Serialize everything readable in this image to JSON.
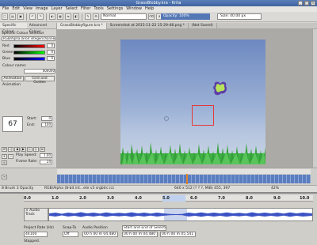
{
  "window": {
    "title": "GrassBlobby.kra - Krita"
  },
  "menubar": [
    "File",
    "Edit",
    "View",
    "Image",
    "Layer",
    "Select",
    "Filter",
    "Tools",
    "Settings",
    "Window",
    "Help"
  ],
  "toolbar": {
    "blend_mode": "Normal",
    "opacity": "Opacity: 100%",
    "size": "Size: 40.00 px"
  },
  "tabs": [
    {
      "label": "Specific Colour..."
    },
    {
      "label": "Advanced Colour..."
    },
    {
      "label": "GrassBlobbyfigure.kra *"
    },
    {
      "label": "Screenshot at 2015-11-22 15-29-48.png *"
    },
    {
      "label": "(Not Saved)"
    }
  ],
  "left_panel": {
    "tabs": [
      "Specific Colour...",
      "Advanced Colour..."
    ],
    "color_model_label": "Specific Colour Selector",
    "color_space": "RGB/Alpha (8-bit integer/channel)",
    "channels": [
      {
        "name": "Red",
        "value": "0"
      },
      {
        "name": "Green",
        "value": "0"
      },
      {
        "name": "Blue",
        "value": "0"
      }
    ],
    "colour_name_label": "Colour name:",
    "hex_value": "000000",
    "animation_tab": "Animation",
    "grid_tab": "Grid and Guides",
    "animation_label": "Animation",
    "current_frame": "67",
    "start_label": "Start:",
    "start_value": "0",
    "end_label": "End:",
    "end_value": "100",
    "play_speed_label": "Play Speed:",
    "play_speed": "1.00",
    "frame_rate_label": "Frame Rate:",
    "frame_rate": "24"
  },
  "statusbar": {
    "color_info": "8 Brush 3 Opacity",
    "layer_info": "RGB/Alpha (8-bit int...ete v3 srgbtrc.icc",
    "size_info": "640 x 512 (? ? ?, MiB)  455, 397",
    "zoom": "42%"
  },
  "audacity": {
    "ruler_ticks": [
      "0.0",
      "1.0",
      "2.0",
      "3.0",
      "4.0",
      "5.0",
      "6.0",
      "7.0",
      "8.0",
      "9.0",
      "10.0"
    ],
    "track_name": "Audio Track",
    "project_rate_label": "Project Rate (Hz)",
    "project_rate": "44100",
    "snap_label": "Snap-To",
    "snap_value": "Off",
    "audio_position_label": "Audio Position",
    "audio_position": "00 h 00 m 04.480 s",
    "selection_label": "Start and End of Selection",
    "selection_start": "00 h 00 m 04.480 s",
    "selection_end": "00 h 00 m 05.541 s",
    "status": "Stopped."
  },
  "colors": {
    "accent": "#5477b6",
    "grass": "#3fb043",
    "selection": "#e53935",
    "blob": "#b7e35a"
  }
}
